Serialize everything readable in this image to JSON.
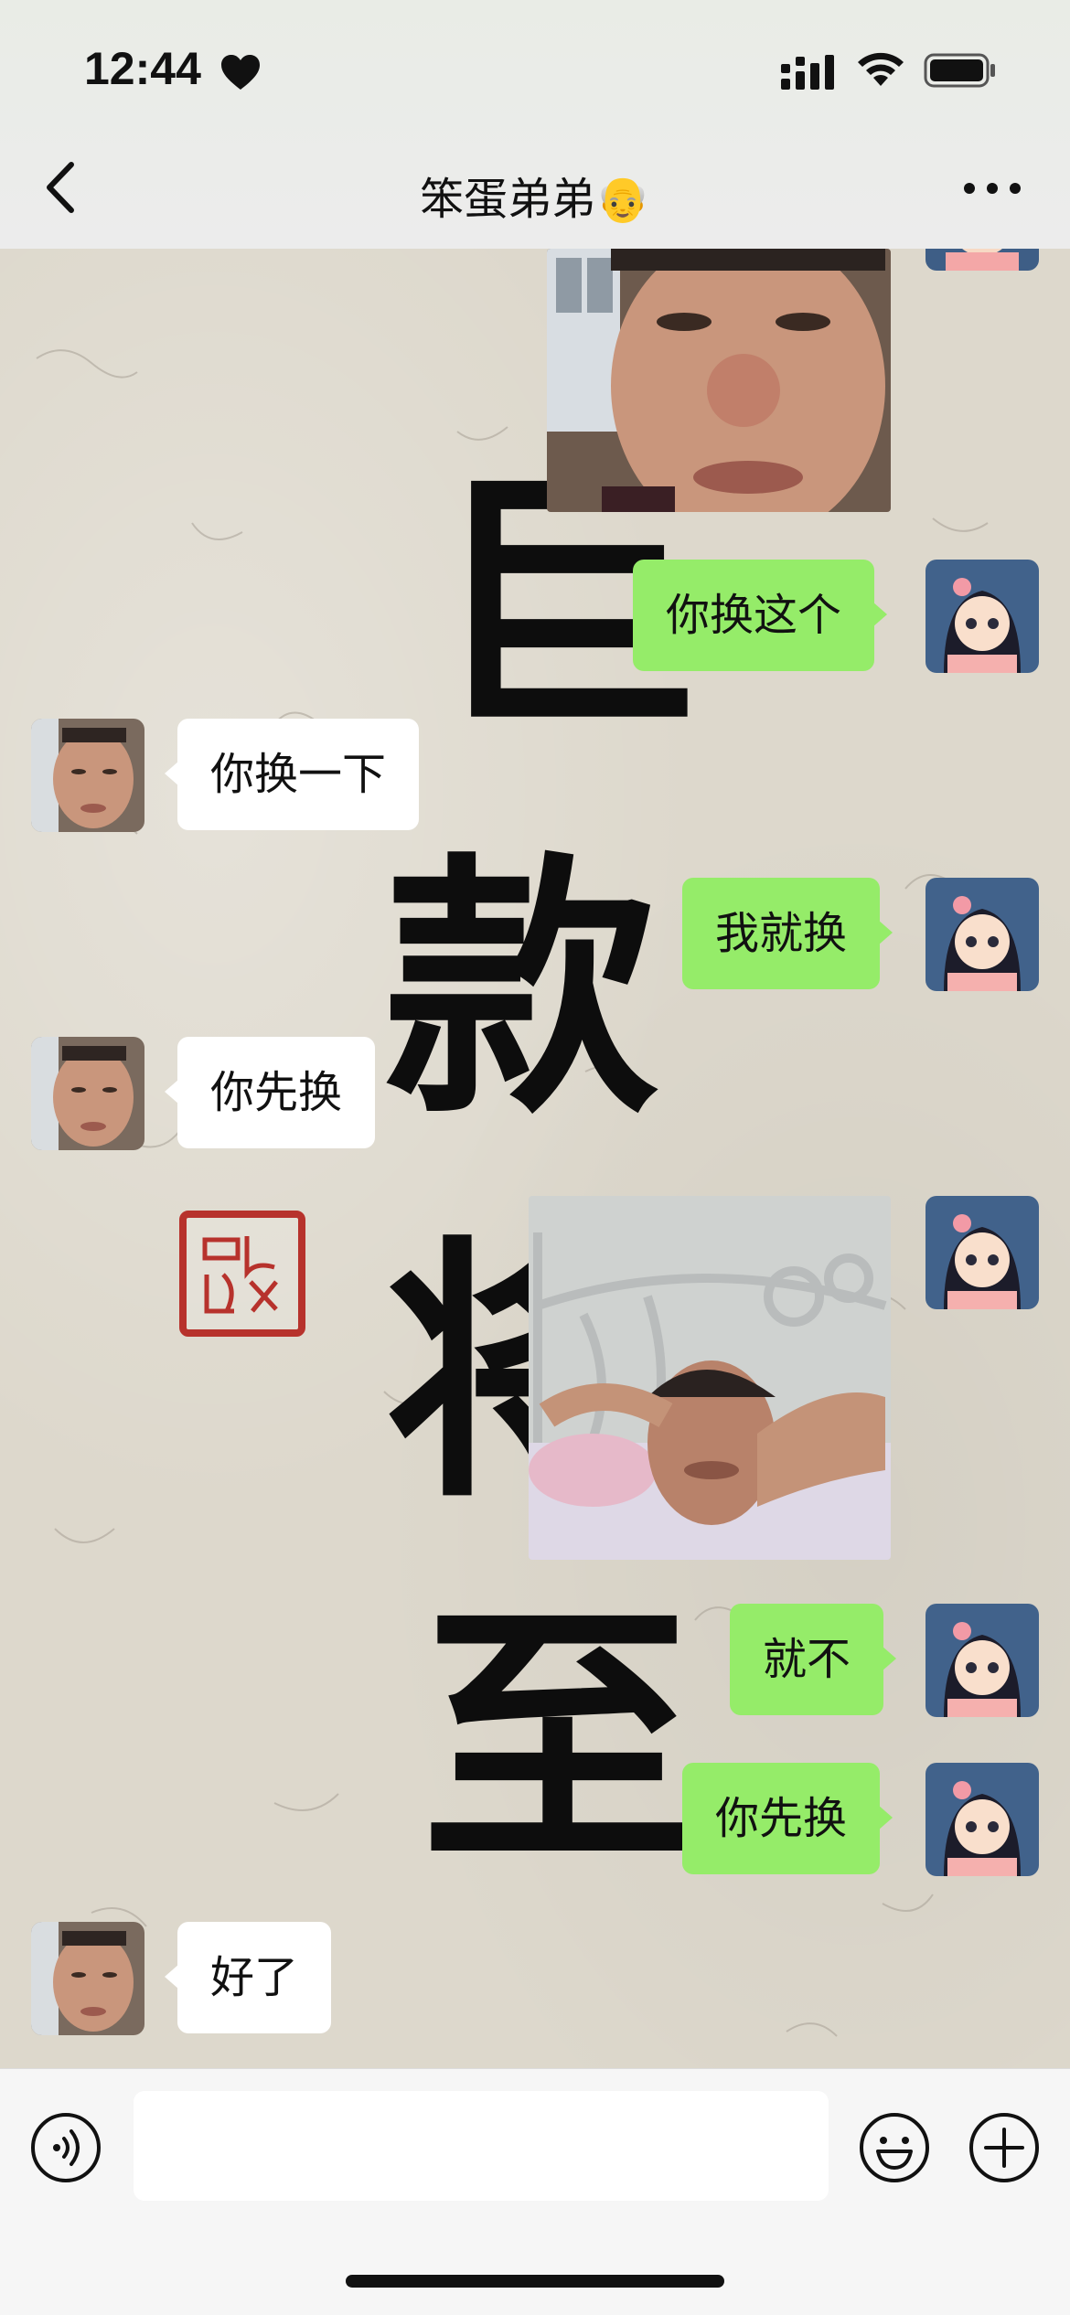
{
  "status_bar": {
    "time": "12:44",
    "icons": [
      "heart-icon",
      "cellular-signal-icon",
      "wifi-icon",
      "battery-icon"
    ]
  },
  "nav": {
    "back_icon": "chevron-left-icon",
    "title": "笨蛋弟弟👴",
    "more_icon": "more-dots-icon"
  },
  "wallpaper": {
    "calligraphy": [
      "巨",
      "款",
      "将",
      "至"
    ]
  },
  "messages": [
    {
      "from": "me",
      "type": "image",
      "description_icon": "photo-crying-man"
    },
    {
      "from": "me",
      "type": "text",
      "text": "你换这个"
    },
    {
      "from": "them",
      "type": "text",
      "text": "你换一下"
    },
    {
      "from": "me",
      "type": "text",
      "text": "我就换"
    },
    {
      "from": "them",
      "type": "text",
      "text": "你先换"
    },
    {
      "from": "me",
      "type": "image",
      "description_icon": "photo-man-in-bed"
    },
    {
      "from": "me",
      "type": "text",
      "text": "就不"
    },
    {
      "from": "me",
      "type": "text",
      "text": "你先换"
    },
    {
      "from": "them",
      "type": "text",
      "text": "好了"
    }
  ],
  "input_bar": {
    "voice_icon": "voice-icon",
    "input_value": "",
    "emoji_icon": "emoji-icon",
    "plus_icon": "plus-icon"
  },
  "colors": {
    "my_bubble": "#95ec69",
    "their_bubble": "#ffffff",
    "seal_red": "#b7322c",
    "wallpaper": "#ddd8cc"
  }
}
